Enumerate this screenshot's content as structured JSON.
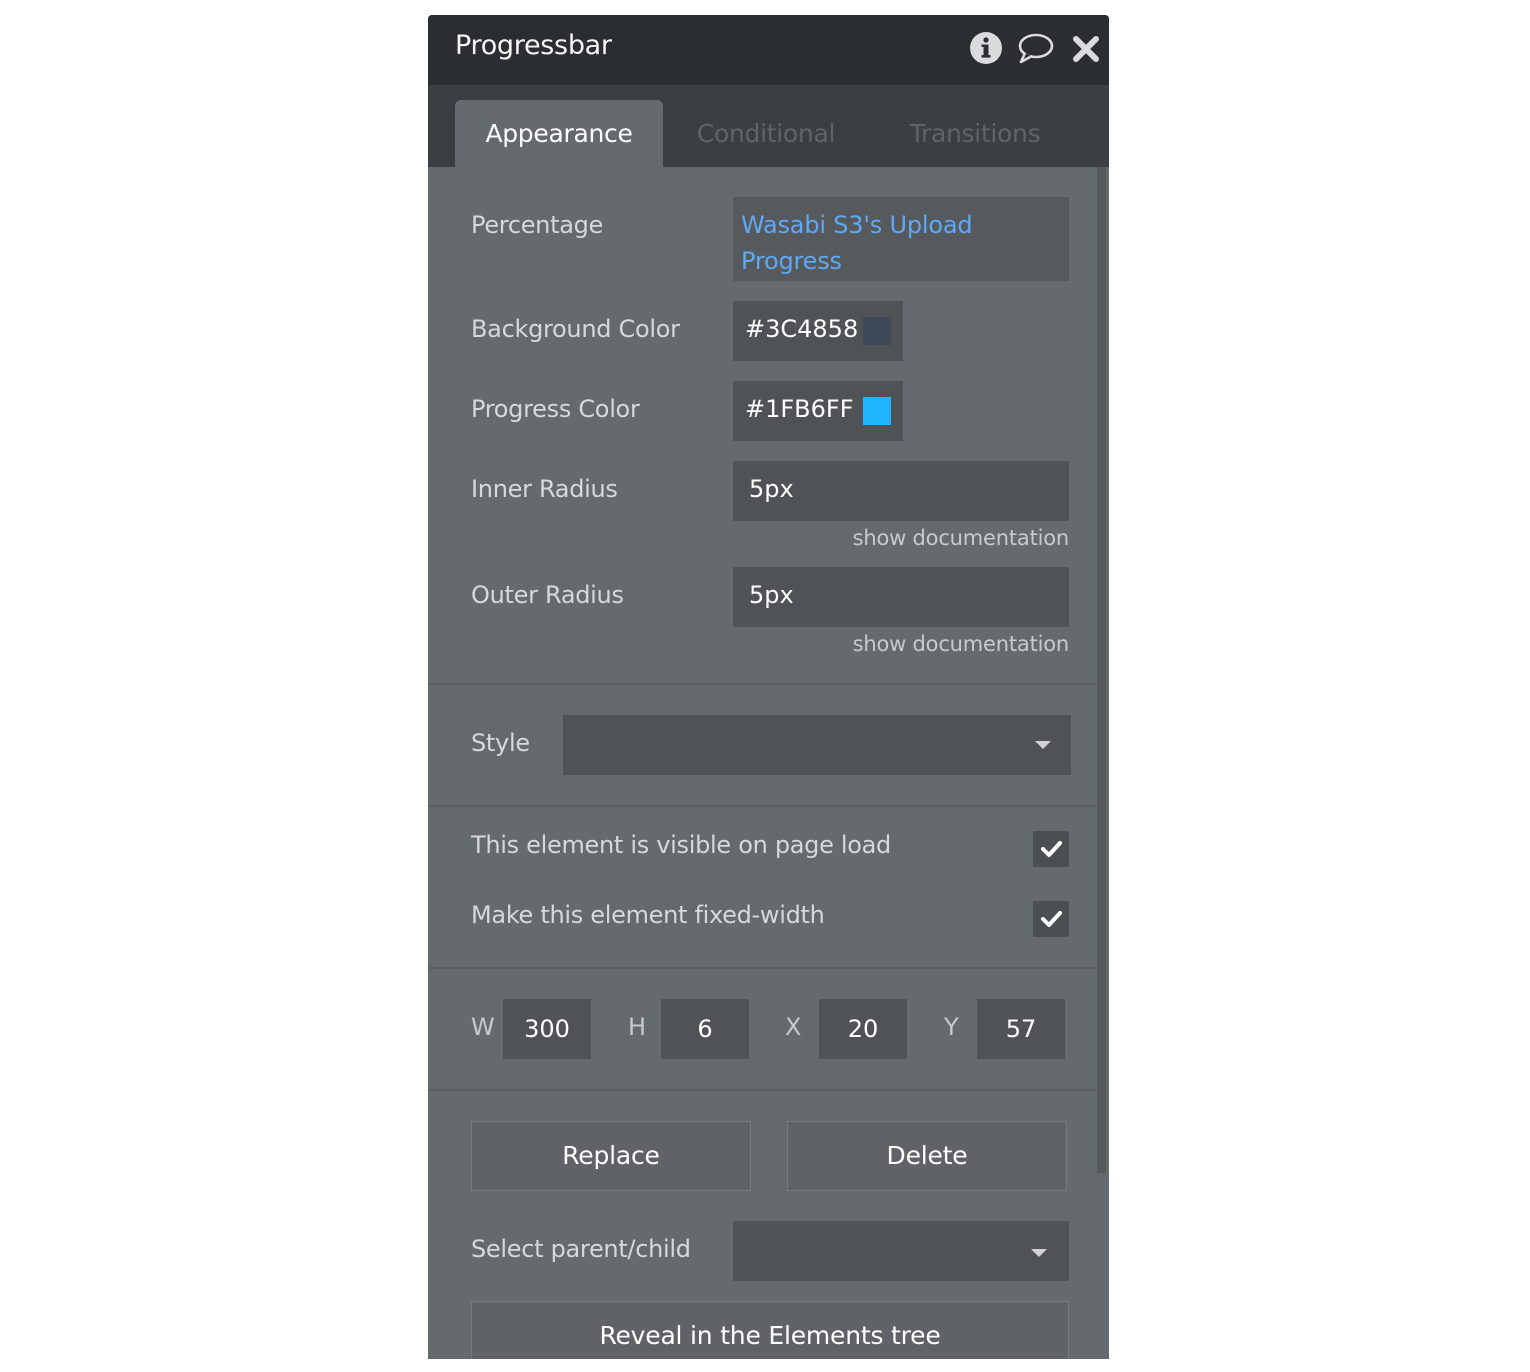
{
  "panel": {
    "title": "Progressbar"
  },
  "tabs": [
    {
      "label": "Appearance"
    },
    {
      "label": "Conditional"
    },
    {
      "label": "Transitions"
    }
  ],
  "percentage": {
    "label": "Percentage",
    "value_line1": "Wasabi S3's Upload",
    "value_line2": "Progress"
  },
  "background_color": {
    "label": "Background Color",
    "value": "#3C4858",
    "swatch": "#3C4858"
  },
  "progress_color": {
    "label": "Progress Color",
    "value": "#1FB6FF",
    "swatch": "#1FB6FF"
  },
  "inner_radius": {
    "label": "Inner Radius",
    "value": "5px",
    "doc_link": "show documentation"
  },
  "outer_radius": {
    "label": "Outer Radius",
    "value": "5px",
    "doc_link": "show documentation"
  },
  "style": {
    "label": "Style",
    "value": ""
  },
  "visible_on_load": {
    "label": "This element is visible on page load",
    "checked": true
  },
  "fixed_width": {
    "label": "Make this element fixed-width",
    "checked": true
  },
  "dimensions": {
    "w_label": "W",
    "w_value": "300",
    "h_label": "H",
    "h_value": "6",
    "x_label": "X",
    "x_value": "20",
    "y_label": "Y",
    "y_value": "57"
  },
  "actions": {
    "replace_label": "Replace",
    "delete_label": "Delete"
  },
  "select_parent": {
    "label": "Select parent/child",
    "value": ""
  },
  "reveal": {
    "label": "Reveal in the Elements tree"
  },
  "icons": {
    "info": "info-icon",
    "comment": "comment-icon",
    "close": "close-icon",
    "check": "check-icon",
    "dropdown": "chevron-down-icon"
  }
}
